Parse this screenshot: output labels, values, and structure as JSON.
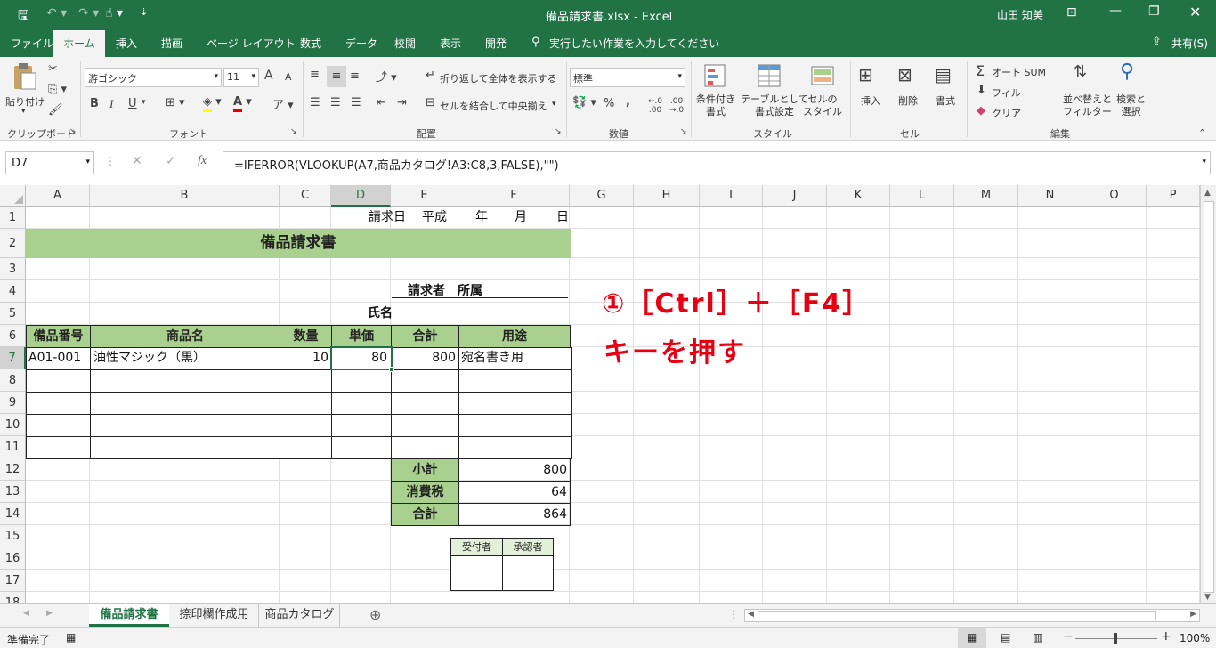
{
  "window": {
    "title": "備品請求書.xlsx - Excel",
    "user": "山田 知美",
    "qat_more": "⇣"
  },
  "tabs": [
    "ファイル",
    "ホーム",
    "挿入",
    "描画",
    "ページ レイアウト",
    "数式",
    "データ",
    "校閲",
    "表示",
    "開発"
  ],
  "tell_me": "実行したい作業を入力してください",
  "share": "共有(S)",
  "ribbon": {
    "clipboard": {
      "paste": "貼り付け",
      "group": "クリップボード"
    },
    "font": {
      "name": "游ゴシック",
      "size": "11",
      "group": "フォント",
      "grow": "A",
      "shrink": "A",
      "bold": "B",
      "italic": "I",
      "underline": "U",
      "color_letter": "A"
    },
    "alignment": {
      "wrap": "折り返して全体を表示する",
      "merge": "セルを結合して中央揃え",
      "group": "配置"
    },
    "number": {
      "format": "標準",
      "percent": "%",
      "comma": ",",
      "group": "数値"
    },
    "styles": {
      "conditional": "条件付き\n書式",
      "table": "テーブルとして\n書式設定",
      "cell": "セルの\nスタイル",
      "group": "スタイル"
    },
    "cells": {
      "insert": "挿入",
      "delete": "削除",
      "format": "書式",
      "group": "セル"
    },
    "editing": {
      "autosum": "オート SUM",
      "fill": "フィル",
      "clear": "クリア",
      "sort": "並べ替えと\nフィルター",
      "find": "検索と\n選択",
      "group": "編集"
    }
  },
  "formula_bar": {
    "name_box": "D7",
    "fx": "fx",
    "formula": "=IFERROR(VLOOKUP(A7,商品カタログ!A3:C8,3,FALSE),\"\")"
  },
  "columns": [
    "A",
    "B",
    "C",
    "D",
    "E",
    "F",
    "G",
    "H",
    "I",
    "J",
    "K",
    "L",
    "M",
    "N",
    "O",
    "P"
  ],
  "rows": [
    "1",
    "2",
    "3",
    "4",
    "5",
    "6",
    "7",
    "8",
    "9",
    "10",
    "11",
    "12",
    "13",
    "14",
    "15",
    "16",
    "17",
    "18"
  ],
  "sheet": {
    "r1": {
      "request_date": "請求日",
      "era": "平成",
      "year": "年",
      "month": "月",
      "day": "日"
    },
    "title": "備品請求書",
    "requester": "請求者　所属",
    "name": "氏名",
    "headers": [
      "備品番号",
      "商品名",
      "数量",
      "単価",
      "合計",
      "用途"
    ],
    "row7": [
      "A01-001",
      "油性マジック（黒）",
      "10",
      "80",
      "800",
      "宛名書き用"
    ],
    "subtotal_label": "小計",
    "subtotal": "800",
    "tax_label": "消費税",
    "tax": "64",
    "total_label": "合計",
    "total": "864",
    "stamp": [
      "受付者",
      "承認者"
    ]
  },
  "annotation": {
    "line1": "①［Ctrl］＋［F4］",
    "line2": "キーを押す",
    "color": "#e60012"
  },
  "sheet_tabs": [
    "備品請求書",
    "捺印欄作成用",
    "商品カタログ"
  ],
  "status": {
    "ready": "準備完了",
    "zoom": "100%"
  },
  "colors": {
    "excel_green": "#217346",
    "header_fill": "#a9d08e"
  }
}
